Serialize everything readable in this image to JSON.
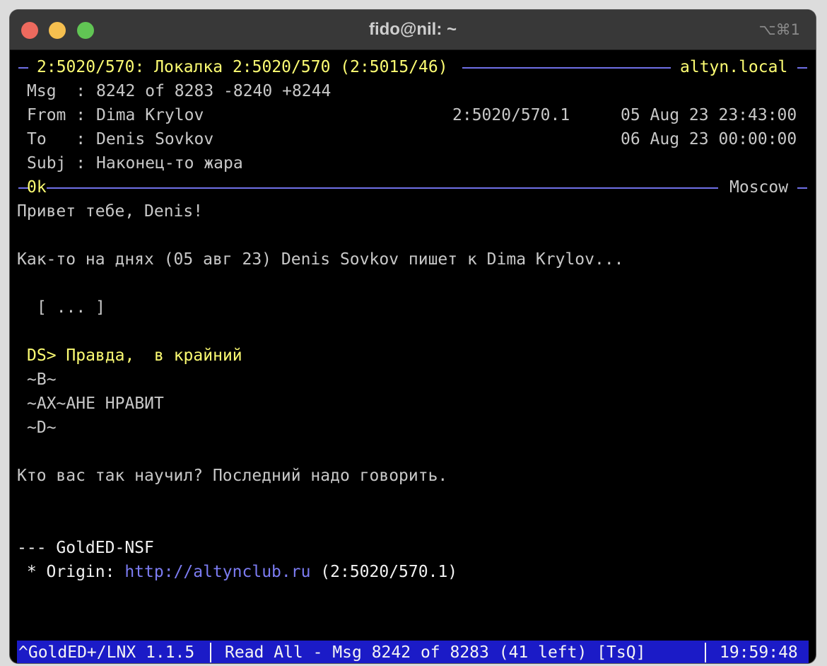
{
  "window": {
    "title": "fido@nil: ~",
    "shortcut": "⌥⌘1"
  },
  "header": {
    "area": "2:5020/570: Локалка 2:5020/570 (2:5015/46)",
    "host": "altyn.local",
    "msg_label": "Msg  :",
    "msg_value": "8242 of 8283 -8240 +8244",
    "from_label": "From :",
    "from_name": "Dima Krylov",
    "from_addr": "2:5020/570.1",
    "from_date": "05 Aug 23 23:43:00",
    "to_label": "To   :",
    "to_name": "Denis Sovkov",
    "to_date": "06 Aug 23 00:00:00",
    "subj_label": "Subj :",
    "subj_value": "Наконец-то жара",
    "size": "0k",
    "location": "Moscow"
  },
  "body": {
    "greeting": "Привет тебе, Denis!",
    "intro": "Как-то на днях (05 авг 23) Denis Sovkov пишет к Dima Krylov...",
    "snip": "[ ... ]",
    "quote": "DS> Правда,  в крайний",
    "tilde_b": "~B~",
    "tilde_ax": "~AX~AHE HPAВИT",
    "tilde_d": "~D~",
    "reply": "Кто вас так научил? Последний надо говорить.",
    "tearline": "--- GoldED-NSF",
    "origin_label": " * Origin: ",
    "origin_url": "http://altynclub.ru",
    "origin_addr": " (2:5020/570.1)"
  },
  "status": {
    "program": "^GoldED+/LNX 1.1.5",
    "mode": "Read All - Msg 8242 of 8283 (41 left) [TsQ]",
    "time": "19:59:48"
  }
}
